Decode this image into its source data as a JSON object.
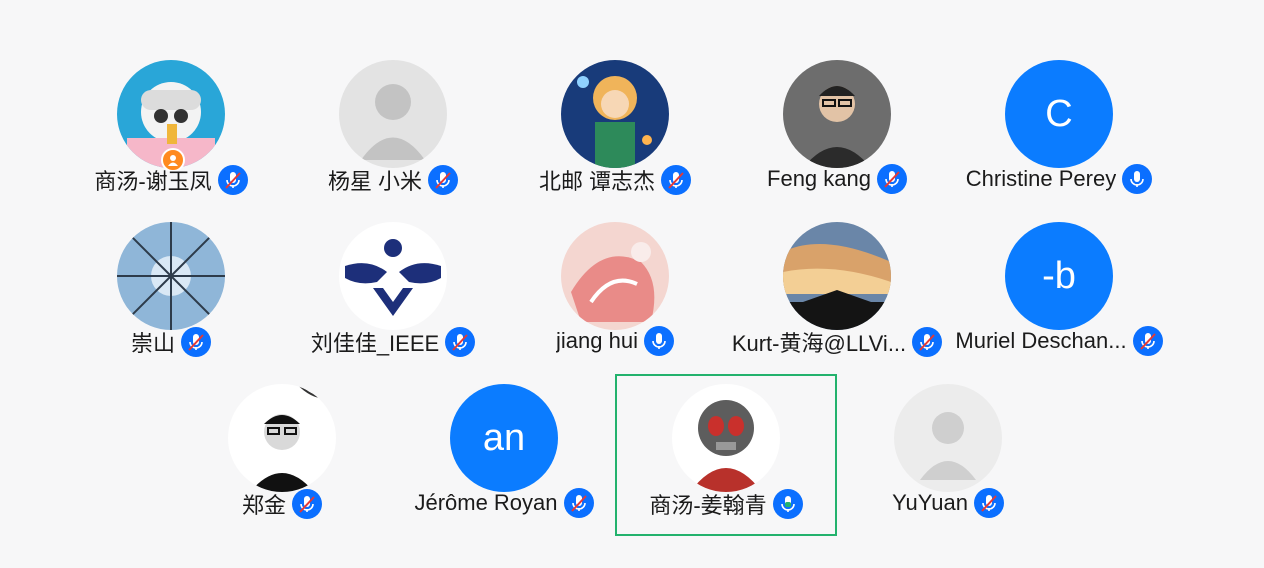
{
  "colors": {
    "accent": "#0b6fff",
    "speaking": "#23b26d",
    "host_badge": "#ff8a1f",
    "muted_slash": "#e53935"
  },
  "participants": [
    {
      "name": "商汤-谢玉凤",
      "mic": "muted",
      "avatar": "cartoon-girl",
      "host": true
    },
    {
      "name": "杨星 小米",
      "mic": "muted",
      "avatar": "default-person"
    },
    {
      "name": "北邮 谭志杰",
      "mic": "muted",
      "avatar": "anime-scene"
    },
    {
      "name": "Feng kang",
      "mic": "muted",
      "avatar": "photo-man"
    },
    {
      "name": "Christine Perey",
      "mic": "on",
      "avatar_letter": "C"
    },
    {
      "name": "崇山",
      "mic": "muted",
      "avatar": "forest-sky"
    },
    {
      "name": "刘佳佳_IEEE",
      "mic": "muted",
      "avatar": "bee-logo"
    },
    {
      "name": "jiang hui",
      "mic": "on",
      "avatar": "pink-painting"
    },
    {
      "name": "Kurt-黄海@LLVi...",
      "mic": "muted",
      "avatar": "sunset-temple"
    },
    {
      "name": "Muriel Deschan...",
      "mic": "muted",
      "avatar_letter": "-b"
    },
    {
      "name": "郑金",
      "mic": "muted",
      "avatar": "sketch-man"
    },
    {
      "name": "Jérôme Royan",
      "mic": "muted",
      "avatar_letter": "an"
    },
    {
      "name": "商汤-姜翰青",
      "mic": "speaking",
      "avatar": "antman",
      "speaking": true
    },
    {
      "name": "YuYuan",
      "mic": "muted",
      "avatar": "default-person-light"
    }
  ]
}
